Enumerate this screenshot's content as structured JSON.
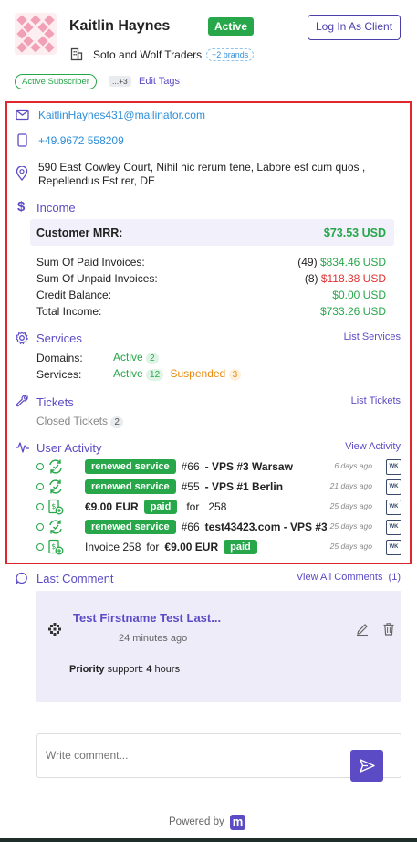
{
  "client": {
    "name": "Kaitlin Haynes",
    "status": "Active",
    "company": "Soto and Wolf Traders",
    "brands": "+2 brands",
    "login_button": "Log In As Client"
  },
  "tags": {
    "tag": "Active Subscriber",
    "more": "...+3",
    "edit": "Edit Tags"
  },
  "contact": {
    "email": "KaitlinHaynes431@mailinator.com",
    "phone": "+49.9672 558209",
    "address_line1": "590 East Cowley Court, Nihil hic rerum tene, Labore est cum quos ,",
    "address_line2": "Repellendus Est rer, DE"
  },
  "income": {
    "title": "Income",
    "mrr_label": "Customer MRR:",
    "mrr_value": "$73.53 USD",
    "paid_label": "Sum Of Paid Invoices:",
    "paid_count": "(49)",
    "paid_value": "$834.46 USD",
    "unpaid_label": "Sum Of Unpaid Invoices:",
    "unpaid_count": "(8)",
    "unpaid_value": "$118.38 USD",
    "credit_label": "Credit Balance:",
    "credit_value": "$0.00 USD",
    "total_label": "Total Income:",
    "total_value": "$733.26 USD"
  },
  "services": {
    "title": "Services",
    "link": "List Services",
    "domains_label": "Domains:",
    "domains_status": "Active",
    "domains_count": "2",
    "services_label": "Services:",
    "services_active": "Active",
    "services_active_count": "12",
    "services_suspended": "Suspended",
    "services_suspended_count": "3"
  },
  "tickets": {
    "title": "Tickets",
    "link": "List Tickets",
    "closed_label": "Closed Tickets",
    "closed_count": "2"
  },
  "activity": {
    "title": "User Activity",
    "link": "View Activity",
    "rows": [
      {
        "badge": "renewed service",
        "id": "#66",
        "text": "- VPS #3 Warsaw",
        "when": "6 days ago",
        "wk": "WK"
      },
      {
        "badge": "renewed service",
        "id": "#55",
        "text": "- VPS #1 Berlin",
        "when": "21 days ago",
        "wk": "WK"
      },
      {
        "amount": "€9.00 EUR",
        "badge": "paid",
        "for": "for",
        "ref": "258",
        "when": "25 days ago",
        "wk": "WK"
      },
      {
        "badge": "renewed service",
        "id": "#66",
        "text": "test43423.com - VPS #3",
        "when": "25 days ago",
        "wk": "WK"
      },
      {
        "invoice": "Invoice 258",
        "for": "for",
        "amount": "€9.00 EUR",
        "badge": "paid",
        "when": "25 days ago",
        "wk": "WK"
      }
    ]
  },
  "comment": {
    "title": "Last Comment",
    "link": "View All Comments",
    "count": "(1)",
    "author": "Test Firstname Test Last...",
    "time": "24 minutes ago",
    "body_bold": "Priority",
    "body_mid": " support: ",
    "body_bold2": "4",
    "body_end": " hours"
  },
  "composer": {
    "placeholder": "Write comment..."
  },
  "footer": {
    "powered": "Powered by",
    "logo_letter": "m"
  },
  "colors": {
    "accent": "#5b4bc4",
    "success": "#27a74a",
    "danger": "#e03131",
    "warning": "#e8890c",
    "highlight_border": "#e0262e"
  }
}
